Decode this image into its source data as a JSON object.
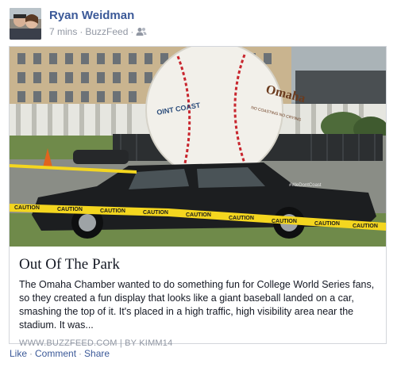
{
  "post": {
    "author": "Ryan Weidman",
    "time": "7 mins",
    "app": "BuzzFeed",
    "separator": "·"
  },
  "link_card": {
    "title": "Out Of The Park",
    "description": "The Omaha Chamber wanted to do something fun for College World Series fans, so they created a fun display that looks like a giant baseball landed on a car, smashing the top of it. It's placed in a high traffic, high visibility area near the stadium. It was...",
    "source": "WWW.BUZZFEED.COM | BY KIMM14",
    "image": {
      "ball_text": "Omaha",
      "ball_subtext": "NO COASTING NO CRYING",
      "ball_left_text": "OINT COAST",
      "car_text": "#WeDontCoast",
      "tape_text": "CAUTION"
    }
  },
  "actions": {
    "like": "Like",
    "comment": "Comment",
    "share": "Share",
    "separator": "·"
  },
  "colors": {
    "link": "#3b5998",
    "meta": "#9197a3",
    "border": "#d3d6db",
    "tape": "#f4d61f"
  }
}
